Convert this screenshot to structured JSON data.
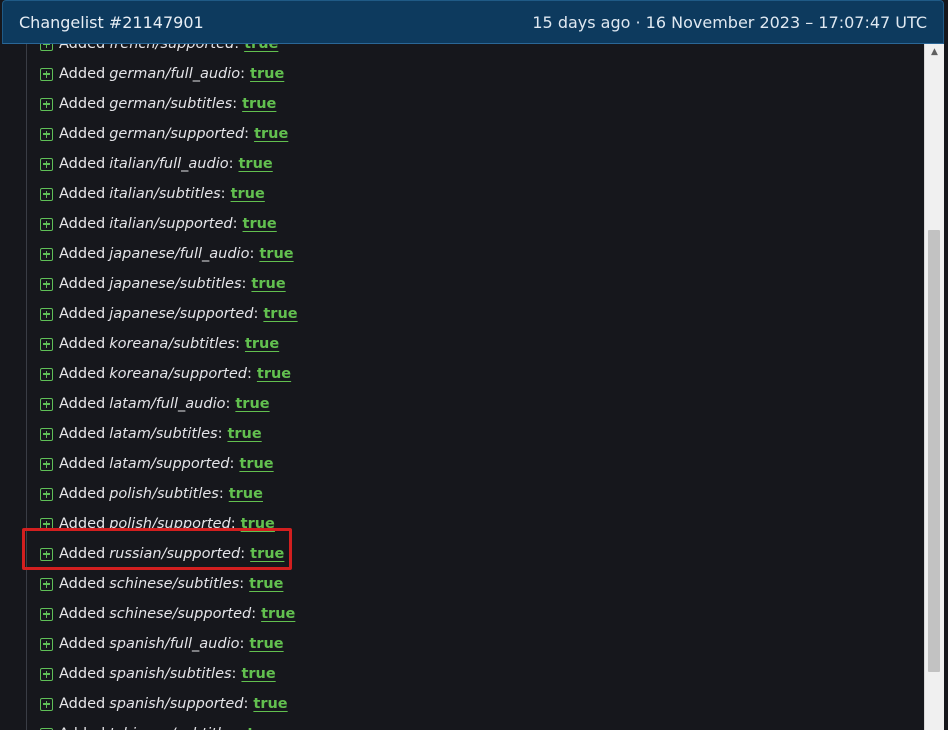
{
  "header": {
    "title": "Changelist #21147901",
    "time": "15 days ago · 16 November 2023 – 17:07:47 UTC"
  },
  "rows": [
    {
      "verb": "Added",
      "key": "french/supported",
      "value": "true"
    },
    {
      "verb": "Added",
      "key": "german/full_audio",
      "value": "true"
    },
    {
      "verb": "Added",
      "key": "german/subtitles",
      "value": "true"
    },
    {
      "verb": "Added",
      "key": "german/supported",
      "value": "true"
    },
    {
      "verb": "Added",
      "key": "italian/full_audio",
      "value": "true"
    },
    {
      "verb": "Added",
      "key": "italian/subtitles",
      "value": "true"
    },
    {
      "verb": "Added",
      "key": "italian/supported",
      "value": "true"
    },
    {
      "verb": "Added",
      "key": "japanese/full_audio",
      "value": "true"
    },
    {
      "verb": "Added",
      "key": "japanese/subtitles",
      "value": "true"
    },
    {
      "verb": "Added",
      "key": "japanese/supported",
      "value": "true"
    },
    {
      "verb": "Added",
      "key": "koreana/subtitles",
      "value": "true"
    },
    {
      "verb": "Added",
      "key": "koreana/supported",
      "value": "true"
    },
    {
      "verb": "Added",
      "key": "latam/full_audio",
      "value": "true"
    },
    {
      "verb": "Added",
      "key": "latam/subtitles",
      "value": "true"
    },
    {
      "verb": "Added",
      "key": "latam/supported",
      "value": "true"
    },
    {
      "verb": "Added",
      "key": "polish/subtitles",
      "value": "true"
    },
    {
      "verb": "Added",
      "key": "polish/supported",
      "value": "true"
    },
    {
      "verb": "Added",
      "key": "russian/supported",
      "value": "true"
    },
    {
      "verb": "Added",
      "key": "schinese/subtitles",
      "value": "true"
    },
    {
      "verb": "Added",
      "key": "schinese/supported",
      "value": "true"
    },
    {
      "verb": "Added",
      "key": "spanish/full_audio",
      "value": "true"
    },
    {
      "verb": "Added",
      "key": "spanish/subtitles",
      "value": "true"
    },
    {
      "verb": "Added",
      "key": "spanish/supported",
      "value": "true"
    },
    {
      "verb": "Added",
      "key": "tchinese/subtitles",
      "value": "true"
    }
  ],
  "scrollbar": {
    "position": 0.27,
    "visible_fraction": 0.66
  },
  "colors": {
    "header_bg": "#0d3a5e",
    "page_bg": "#16171c",
    "added_green": "#62c04f",
    "highlight_red": "#d21f1f"
  },
  "icons": {
    "row": "plus-square-icon",
    "scroll_up": "chevron-up-icon"
  }
}
